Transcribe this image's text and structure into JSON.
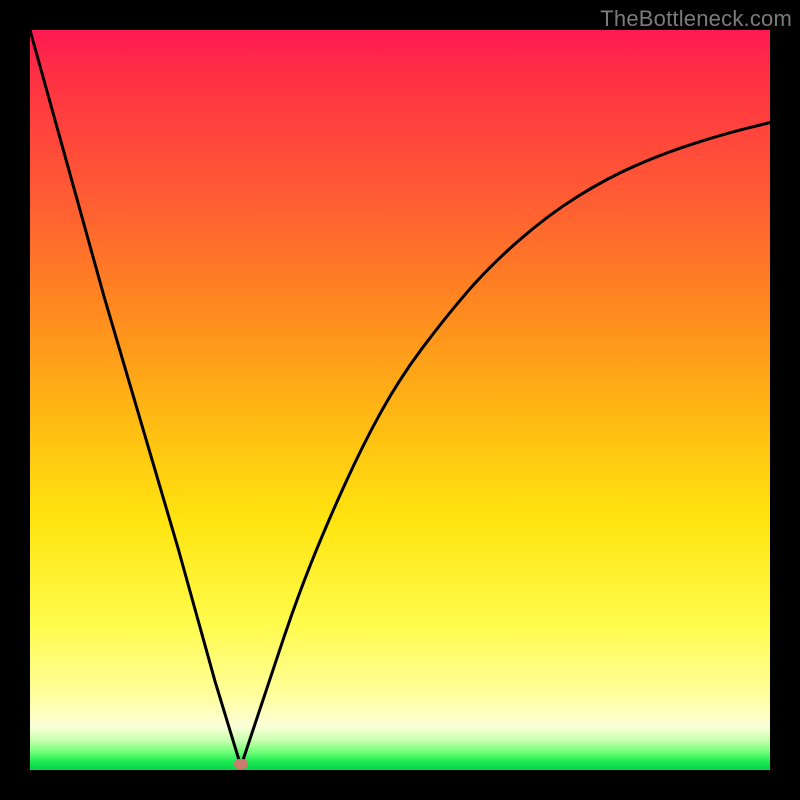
{
  "watermark": "TheBottleneck.com",
  "chart_data": {
    "type": "line",
    "title": "",
    "xlabel": "",
    "ylabel": "",
    "xlim": [
      0,
      100
    ],
    "ylim": [
      0,
      100
    ],
    "grid": false,
    "legend": null,
    "comment": "V-shaped bottleneck curve. Left branch descends nearly linearly from top-left to the minimum; right branch rises with decreasing slope toward upper-right. Minimum (optimal point) marked near x≈28, y≈0.",
    "series": [
      {
        "name": "left-branch",
        "x": [
          0,
          5,
          10,
          15,
          20,
          25,
          28.5
        ],
        "values": [
          100,
          82,
          64,
          47,
          30,
          12,
          0.5
        ]
      },
      {
        "name": "right-branch",
        "x": [
          28.5,
          32,
          36,
          40,
          45,
          50,
          56,
          62,
          70,
          78,
          86,
          94,
          100
        ],
        "values": [
          0.5,
          11,
          23,
          33,
          44,
          53,
          61,
          68,
          75,
          80,
          83.5,
          86,
          87.5
        ]
      }
    ],
    "marker": {
      "x": 28.5,
      "y": 0.8
    },
    "background_gradient_stops": [
      {
        "pct": 0,
        "color": "#ff1a52"
      },
      {
        "pct": 22,
        "color": "#ff5a34"
      },
      {
        "pct": 52,
        "color": "#ffb813"
      },
      {
        "pct": 80,
        "color": "#fffb4a"
      },
      {
        "pct": 96,
        "color": "#c9ffb0"
      },
      {
        "pct": 100,
        "color": "#0ad24e"
      }
    ]
  }
}
